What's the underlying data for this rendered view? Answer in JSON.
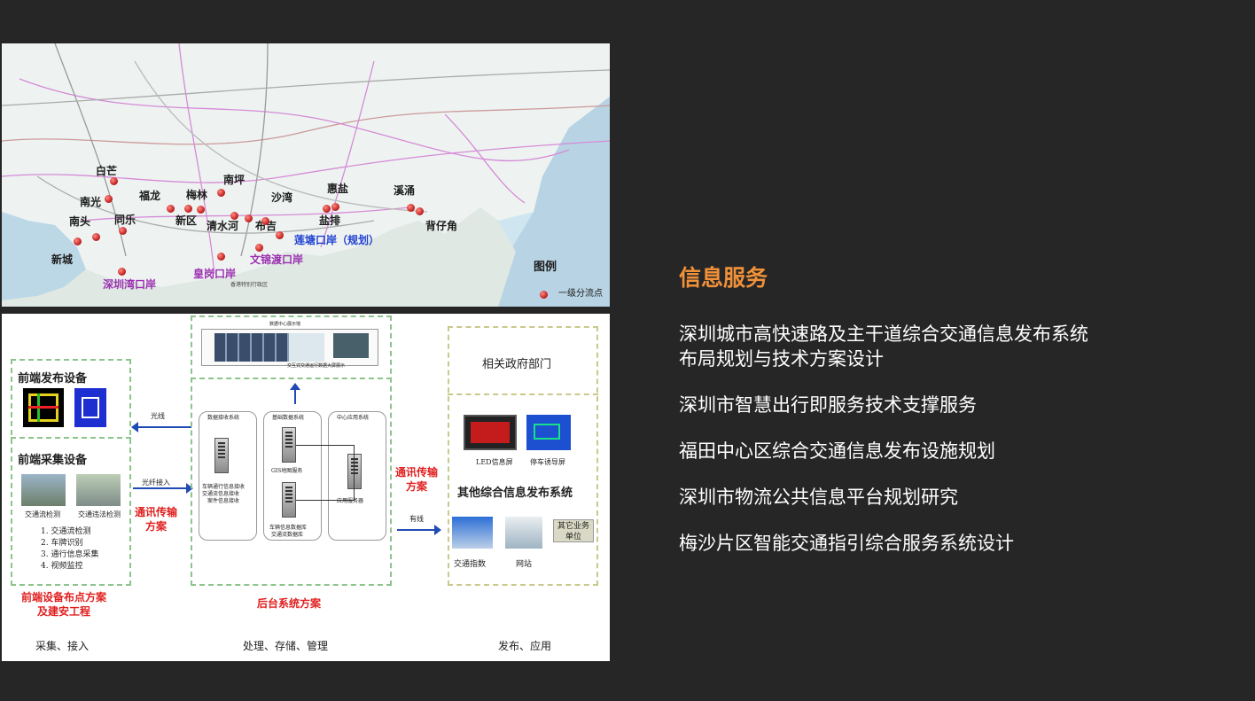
{
  "map": {
    "places": {
      "baimang": "白芒",
      "nanguang": "南光",
      "fulong": "福龙",
      "meilin": "梅林",
      "nanping": "南坪",
      "shawan": "沙湾",
      "huiyan": "惠盐",
      "xiyong": "溪涌",
      "nantou": "南头",
      "tongle": "同乐",
      "xinqu": "新区",
      "qingshuihe": "清水河",
      "buji": "布吉",
      "yanpai": "盐排",
      "beizijiao": "背仔角",
      "xincheng": "新城"
    },
    "ports": {
      "liantang": "莲塘口岸（规划）",
      "wenjindu": "文锦渡口岸",
      "huanggang": "皇岗口岸",
      "shenzhenwan": "深圳湾口岸"
    },
    "hk_label": "香港特别行政区",
    "legend_title": "图例",
    "legend_item": "一级分流点"
  },
  "diagram": {
    "front_release": "前端发布设备",
    "front_collect": "前端采集设备",
    "cam1": "交通流检测",
    "cam2": "交通违法检测",
    "collect_list": [
      "1. 交通流检测",
      "2. 车牌识别",
      "3. 通行信息采集",
      "4. 视频监控"
    ],
    "front_plan": "前端设备布点方案",
    "front_plan2": "及建安工程",
    "arrow_fiber": "光线",
    "arrow_fiber_in": "光纤接入",
    "comm1": "通讯传输",
    "comm1b": "方案",
    "backend_top_caption": "交互式交通运行数据大屏展示",
    "backend_top_title": "数据中心展示墙",
    "col1_title": "数据接收系统",
    "col2_title": "基础数据系统",
    "col3_title": "中心应用系统",
    "col1_text": "车辆通行信息接收",
    "col1_text2": "交通流信息接收",
    "col1_text3": "案件信息接收",
    "col2_gis": "GIS地图服务",
    "col2_db": "车辆信息数据库",
    "col2_db2": "交通流数据库",
    "col3_app": "应用服务器",
    "backend_plan": "后台系统方案",
    "comm2": "通讯传输",
    "comm2b": "方案",
    "wired": "有线",
    "gov": "相关政府部门",
    "led_label": "LED信息屏",
    "park_label": "停车诱导屏",
    "other_sys": "其他综合信息发布系统",
    "other_biz": "其它业务",
    "other_biz2": "单位",
    "index_label": "交通指数",
    "web_label": "网站",
    "foot1": "采集、接入",
    "foot2": "处理、存储、管理",
    "foot3": "发布、应用"
  },
  "section_title": "信息服务",
  "services": [
    {
      "line1": "深圳城市高快速路及主干道综合交通信息发布系统",
      "line2": "布局规划与技术方案设计"
    },
    {
      "line1": "深圳市智慧出行即服务技术支撑服务"
    },
    {
      "line1": "福田中心区综合交通信息发布设施规划"
    },
    {
      "line1": "深圳市物流公共信息平台规划研究"
    },
    {
      "line1": "梅沙片区智能交通指引综合服务系统设计"
    }
  ]
}
